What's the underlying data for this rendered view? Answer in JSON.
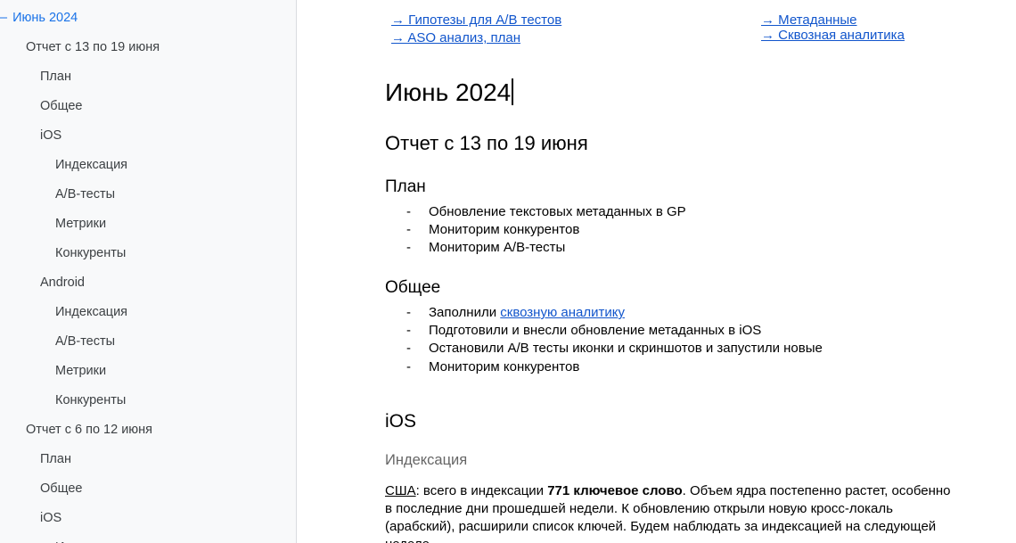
{
  "outline": {
    "items": [
      {
        "label": "Июнь 2024",
        "level": 0,
        "active": true
      },
      {
        "label": "Отчет с 13 по 19 июня",
        "level": 1
      },
      {
        "label": "План",
        "level": 2
      },
      {
        "label": "Общее",
        "level": 2
      },
      {
        "label": "iOS",
        "level": 2
      },
      {
        "label": "Индексация",
        "level": 3
      },
      {
        "label": "A/B-тесты",
        "level": 3
      },
      {
        "label": "Метрики",
        "level": 3
      },
      {
        "label": "Конкуренты",
        "level": 3
      },
      {
        "label": "Android",
        "level": 2
      },
      {
        "label": "Индексация",
        "level": 3
      },
      {
        "label": "A/B-тесты",
        "level": 3
      },
      {
        "label": "Метрики",
        "level": 3
      },
      {
        "label": "Конкуренты",
        "level": 3
      },
      {
        "label": "Отчет с 6 по 12 июня",
        "level": 1
      },
      {
        "label": "План",
        "level": 2
      },
      {
        "label": "Общее",
        "level": 2
      },
      {
        "label": "iOS",
        "level": 2
      },
      {
        "label": "Индексация",
        "level": 3
      }
    ]
  },
  "links": {
    "hypotheses": "→ Гипотезы для A/B тестов",
    "aso": "→ ASO анализ, план",
    "metadata": "→ Метаданные",
    "e2e": "→ Сквозная аналитика"
  },
  "doc": {
    "h1": "Июнь 2024",
    "h2_report": "Отчет с 13 по 19 июня",
    "h3_plan": "План",
    "plan_items": [
      "Обновление текстовых метаданных в GP",
      "Мониторим конкурентов",
      "Мониторим A/B-тесты"
    ],
    "h3_general": "Общее",
    "general_first_prefix": "Заполнили ",
    "general_first_link": "сквозную аналитику",
    "general_items": [
      "Подготовили и внесли обновление метаданных в iOS",
      "Остановили A/B тесты иконки и скриншотов и запустили новые",
      "Мониторим конкурентов"
    ],
    "bullet": "-",
    "h3_ios": "iOS",
    "h4_indexing": "Индексация",
    "para_country": "США",
    "para_part1": ": всего в индексации ",
    "para_bold": "771 ключевое слово",
    "para_part2": ". Объем ядра постепенно растет, особенно в последние дни прошедшей недели. К обновлению открыли новую кросс-локаль (арабский), расширили список ключей. Будем наблюдать за индексацией на следующей неделе."
  }
}
